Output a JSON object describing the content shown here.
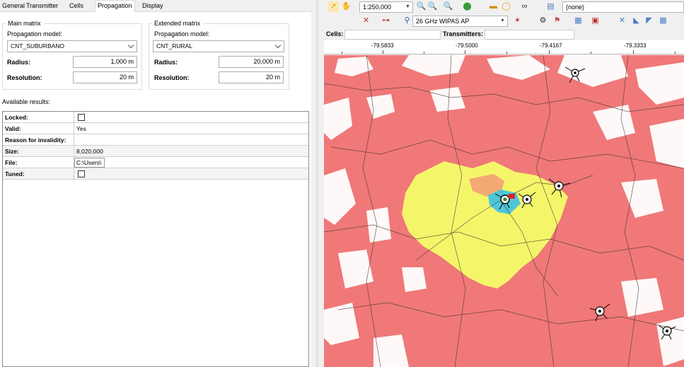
{
  "tabs": [
    "General",
    "Transmitter",
    "Cells",
    "Propagation",
    "Display"
  ],
  "main_matrix": {
    "title": "Main matrix",
    "model_label": "Propagation model:",
    "model_value": "CNT_SUBURBANO",
    "radius_label": "Radius:",
    "radius_value": "1,000  m",
    "resolution_label": "Resolution:",
    "resolution_value": "20  m"
  },
  "extended_matrix": {
    "title": "Extended matrix",
    "model_label": "Propagation model:",
    "model_value": "CNT_RURAL",
    "radius_label": "Radius:",
    "radius_value": "20,000  m",
    "resolution_label": "Resolution:",
    "resolution_value": "20  m"
  },
  "available_results_label": "Available results:",
  "results": [
    {
      "key": "Locked:",
      "value": "",
      "type": "checkbox"
    },
    {
      "key": "Valid:",
      "value": "Yes",
      "type": "text"
    },
    {
      "key": "Reason for invalidity:",
      "value": "",
      "type": "text"
    },
    {
      "key": "Size:",
      "value": "8,020,000",
      "type": "text"
    },
    {
      "key": "File:",
      "value": "C:\\Users\\",
      "type": "field"
    },
    {
      "key": "Tuned:",
      "value": "",
      "type": "checkbox"
    }
  ],
  "toolbar": {
    "scale_value": "1:250,000",
    "layer_value": "(none)",
    "transmitter_type": "26 GHz WIPAS AP"
  },
  "cells_label": "Cells:",
  "transmitters_label": "Transmitters:",
  "ruler_labels": [
    "-79.5833",
    "-79.5000",
    "-79.4167",
    "-79.3333"
  ],
  "colors": {
    "coverage_outer": "#f07878",
    "coverage_mid": "#f5f56a",
    "coverage_core": "#4fc6d8",
    "ocean": "#ffffff"
  },
  "icons": [
    "select-arrow-icon",
    "pan-hand-icon",
    "zoom-in-icon",
    "zoom-out-icon",
    "zoom-icon",
    "earth-icon",
    "measure-icon",
    "tooltip-icon",
    "binoculars-icon",
    "layer-icon",
    "transmitter-icon",
    "antenna-icon",
    "ruler-icon",
    "calculate-icon",
    "properties-icon",
    "site-icon"
  ]
}
